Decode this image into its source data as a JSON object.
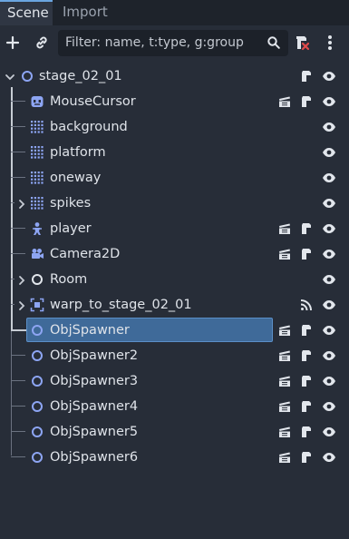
{
  "tabs": {
    "scene": "Scene",
    "import": "Import"
  },
  "toolbar": {
    "filter_placeholder": "Filter: name, t:type, g:group",
    "add_icon": "plus-icon",
    "link_icon": "link-icon",
    "search_icon": "search-icon",
    "script_remove_icon": "remove-script-icon",
    "menu_icon": "kebab-menu-icon"
  },
  "tree": {
    "root": {
      "label": "stage_02_01",
      "icon": "node-circle-icon",
      "expanded": true
    },
    "nodes": [
      {
        "label": "MouseCursor",
        "icon": "sprite-face-icon",
        "scene": true,
        "script": true
      },
      {
        "label": "background",
        "icon": "tilemap-icon"
      },
      {
        "label": "platform",
        "icon": "tilemap-icon"
      },
      {
        "label": "oneway",
        "icon": "tilemap-icon"
      },
      {
        "label": "spikes",
        "icon": "tilemap-icon",
        "collapsed": true
      },
      {
        "label": "player",
        "icon": "character-icon",
        "scene": true,
        "script": true
      },
      {
        "label": "Camera2D",
        "icon": "camera-icon",
        "scene": true,
        "script": true
      },
      {
        "label": "Room",
        "icon": "node-circle-icon",
        "collapsed": true
      },
      {
        "label": "warp_to_stage_02_01",
        "icon": "area-icon",
        "collapsed": true,
        "signal": true
      },
      {
        "label": "ObjSpawner",
        "icon": "node-circle-icon",
        "scene": true,
        "script": true,
        "selected": true
      },
      {
        "label": "ObjSpawner2",
        "icon": "node-circle-icon",
        "scene": true,
        "script": true
      },
      {
        "label": "ObjSpawner3",
        "icon": "node-circle-icon",
        "scene": true,
        "script": true
      },
      {
        "label": "ObjSpawner4",
        "icon": "node-circle-icon",
        "scene": true,
        "script": true
      },
      {
        "label": "ObjSpawner5",
        "icon": "node-circle-icon",
        "scene": true,
        "script": true
      },
      {
        "label": "ObjSpawner6",
        "icon": "node-circle-icon",
        "scene": true,
        "script": true
      }
    ]
  },
  "colors": {
    "panel_bg": "#272d38",
    "selection": "#3f6a99",
    "node_circle": "#8da5f3",
    "tilemap": "#8da5f3",
    "remove_red": "#e04b4b"
  }
}
